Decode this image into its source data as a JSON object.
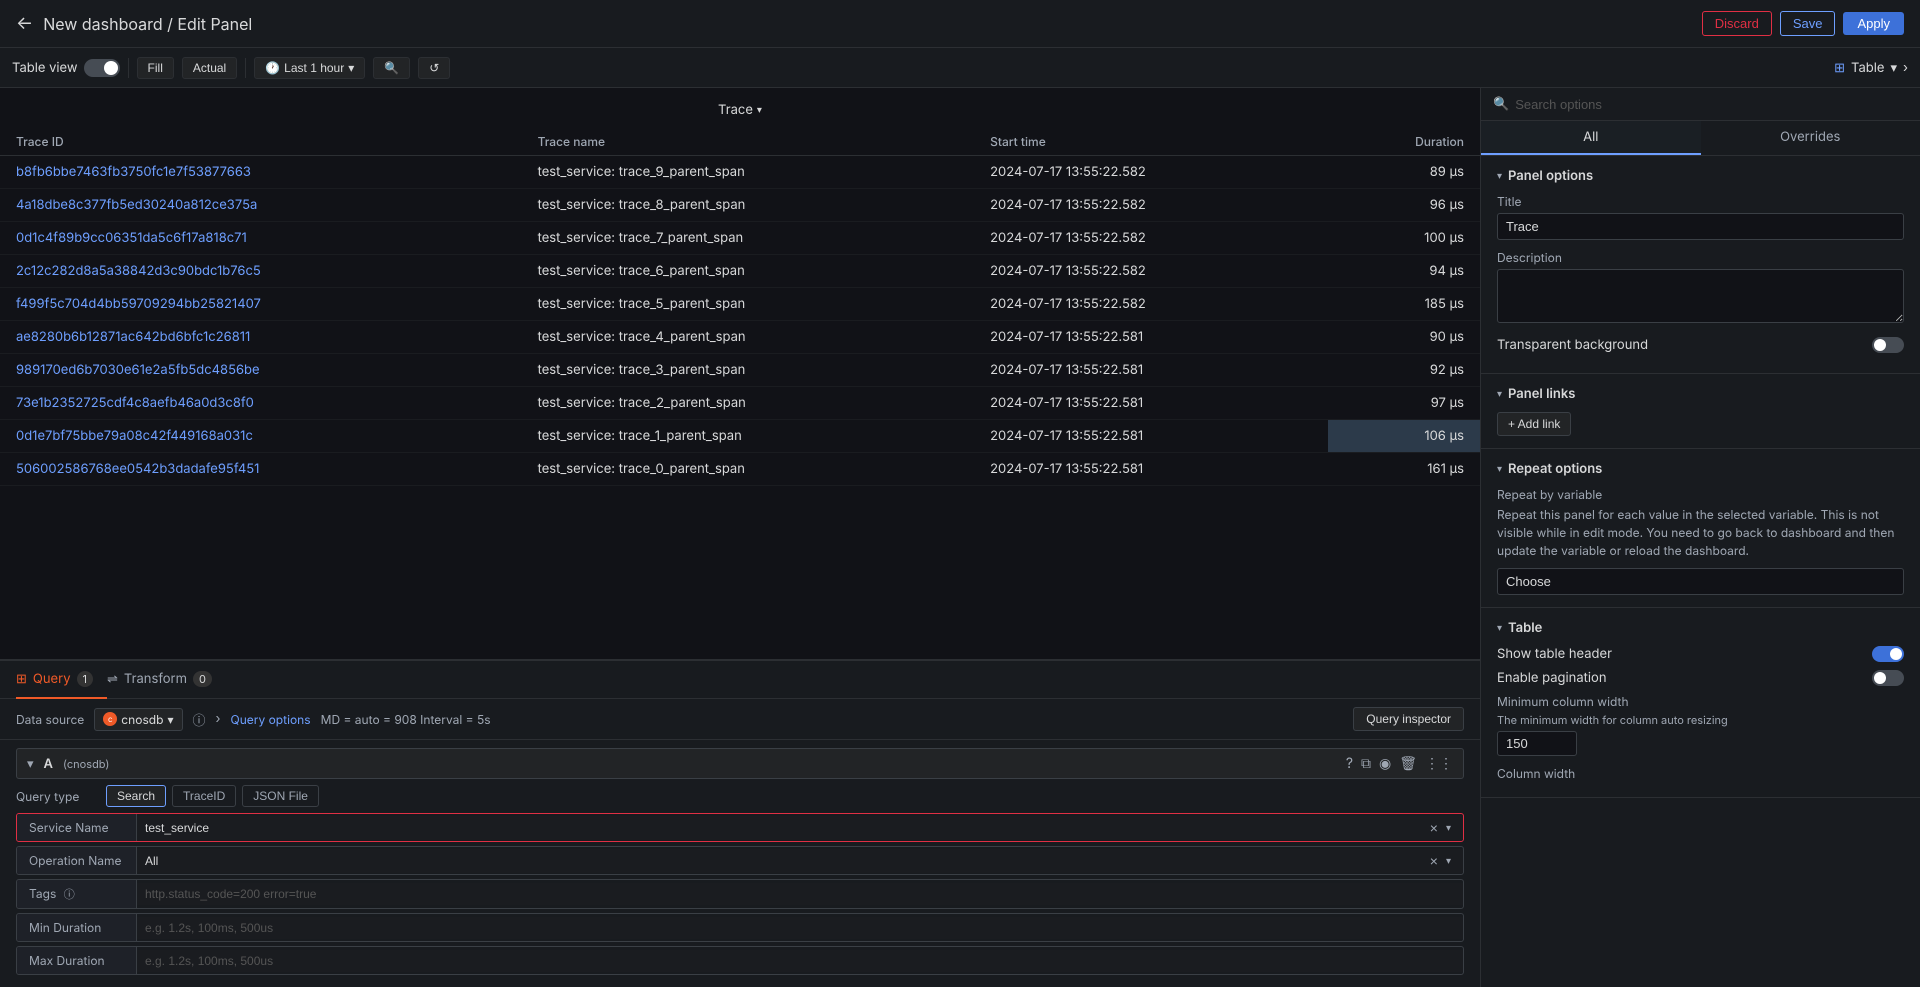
{
  "header": {
    "back_icon": "←",
    "title": "New dashboard / Edit Panel",
    "discard_label": "Discard",
    "save_label": "Save",
    "apply_label": "Apply"
  },
  "toolbar": {
    "table_view_label": "Table view",
    "fill_label": "Fill",
    "actual_label": "Actual",
    "time_range_label": "Last 1 hour",
    "viz_label": "Table",
    "zoom_icon": "🔍",
    "refresh_icon": "↺"
  },
  "data_panel": {
    "trace_header": "Trace",
    "columns": [
      "Trace ID",
      "Trace name",
      "Start time",
      "Duration"
    ],
    "rows": [
      {
        "id": "b8fb6bbe7463fb3750fc1e7f53877663",
        "name": "test_service: trace_9_parent_span",
        "time": "2024-07-17 13:55:22.582",
        "duration": "89 μs"
      },
      {
        "id": "4a18dbe8c377fb5ed30240a812ce375a",
        "name": "test_service: trace_8_parent_span",
        "time": "2024-07-17 13:55:22.582",
        "duration": "96 μs"
      },
      {
        "id": "0d1c4f89b9cc06351da5c6f17a818c71",
        "name": "test_service: trace_7_parent_span",
        "time": "2024-07-17 13:55:22.582",
        "duration": "100 μs"
      },
      {
        "id": "2c12c282d8a5a38842d3c90bdc1b76c5",
        "name": "test_service: trace_6_parent_span",
        "time": "2024-07-17 13:55:22.582",
        "duration": "94 μs"
      },
      {
        "id": "f499f5c704d4bb59709294bb25821407",
        "name": "test_service: trace_5_parent_span",
        "time": "2024-07-17 13:55:22.582",
        "duration": "185 μs"
      },
      {
        "id": "ae8280b6b12871ac642bd6bfc1c26811",
        "name": "test_service: trace_4_parent_span",
        "time": "2024-07-17 13:55:22.581",
        "duration": "90 μs"
      },
      {
        "id": "989170ed6b7030e61e2a5fb5dc4856be",
        "name": "test_service: trace_3_parent_span",
        "time": "2024-07-17 13:55:22.581",
        "duration": "92 μs"
      },
      {
        "id": "73e1b2352725cdf4c8aefb46a0d3c8f0",
        "name": "test_service: trace_2_parent_span",
        "time": "2024-07-17 13:55:22.581",
        "duration": "97 μs"
      },
      {
        "id": "0d1e7bf75bbe79a08c42f449168a031c",
        "name": "test_service: trace_1_parent_span",
        "time": "2024-07-17 13:55:22.581",
        "duration": "106 μs"
      },
      {
        "id": "506002586768ee0542b3dadafe95f451",
        "name": "test_service: trace_0_parent_span",
        "time": "2024-07-17 13:55:22.581",
        "duration": "161 μs"
      }
    ]
  },
  "query_panel": {
    "tabs": [
      {
        "label": "Query",
        "badge": "1",
        "active": true
      },
      {
        "label": "Transform",
        "badge": "0",
        "active": false
      }
    ],
    "datasource_label": "Data source",
    "datasource_name": "cnosdb",
    "query_options_label": "Query options",
    "query_options_meta": "MD = auto = 908   Interval = 5s",
    "query_inspector_label": "Query inspector",
    "query_id": "A",
    "query_id_sub": "(cnosdb)",
    "query_type_label": "Query type",
    "query_types": [
      "Search",
      "TraceID",
      "JSON File"
    ],
    "active_query_type": "Search",
    "service_name_label": "Service Name",
    "service_name_value": "test_service",
    "operation_name_label": "Operation Name",
    "operation_name_value": "All",
    "tags_label": "Tags",
    "tags_placeholder": "http.status_code=200 error=true",
    "min_duration_label": "Min Duration",
    "min_duration_placeholder": "e.g. 1.2s, 100ms, 500us",
    "max_duration_label": "Max Duration",
    "max_duration_placeholder": "e.g. 1.2s, 100ms, 500us"
  },
  "right_panel": {
    "search_placeholder": "Search options",
    "tabs": [
      "All",
      "Overrides"
    ],
    "active_tab": "All",
    "sections": {
      "panel_options": {
        "title": "Panel options",
        "title_label": "Title",
        "title_value": "Trace",
        "description_label": "Description",
        "description_value": "",
        "transparent_bg_label": "Transparent background"
      },
      "panel_links": {
        "title": "Panel links",
        "add_link_label": "+ Add link"
      },
      "repeat_options": {
        "title": "Repeat options",
        "repeat_by_label": "Repeat by variable",
        "repeat_desc": "Repeat this panel for each value in the selected variable. This is not visible while in edit mode. You need to go back to dashboard and then update the variable or reload the dashboard.",
        "choose_placeholder": "Choose"
      },
      "table": {
        "title": "Table",
        "show_table_header_label": "Show table header",
        "enable_pagination_label": "Enable pagination",
        "min_col_width_label": "Minimum column width",
        "min_col_width_note": "The minimum width for column auto resizing",
        "min_col_width_value": "150",
        "col_width_label": "Column width"
      }
    }
  }
}
